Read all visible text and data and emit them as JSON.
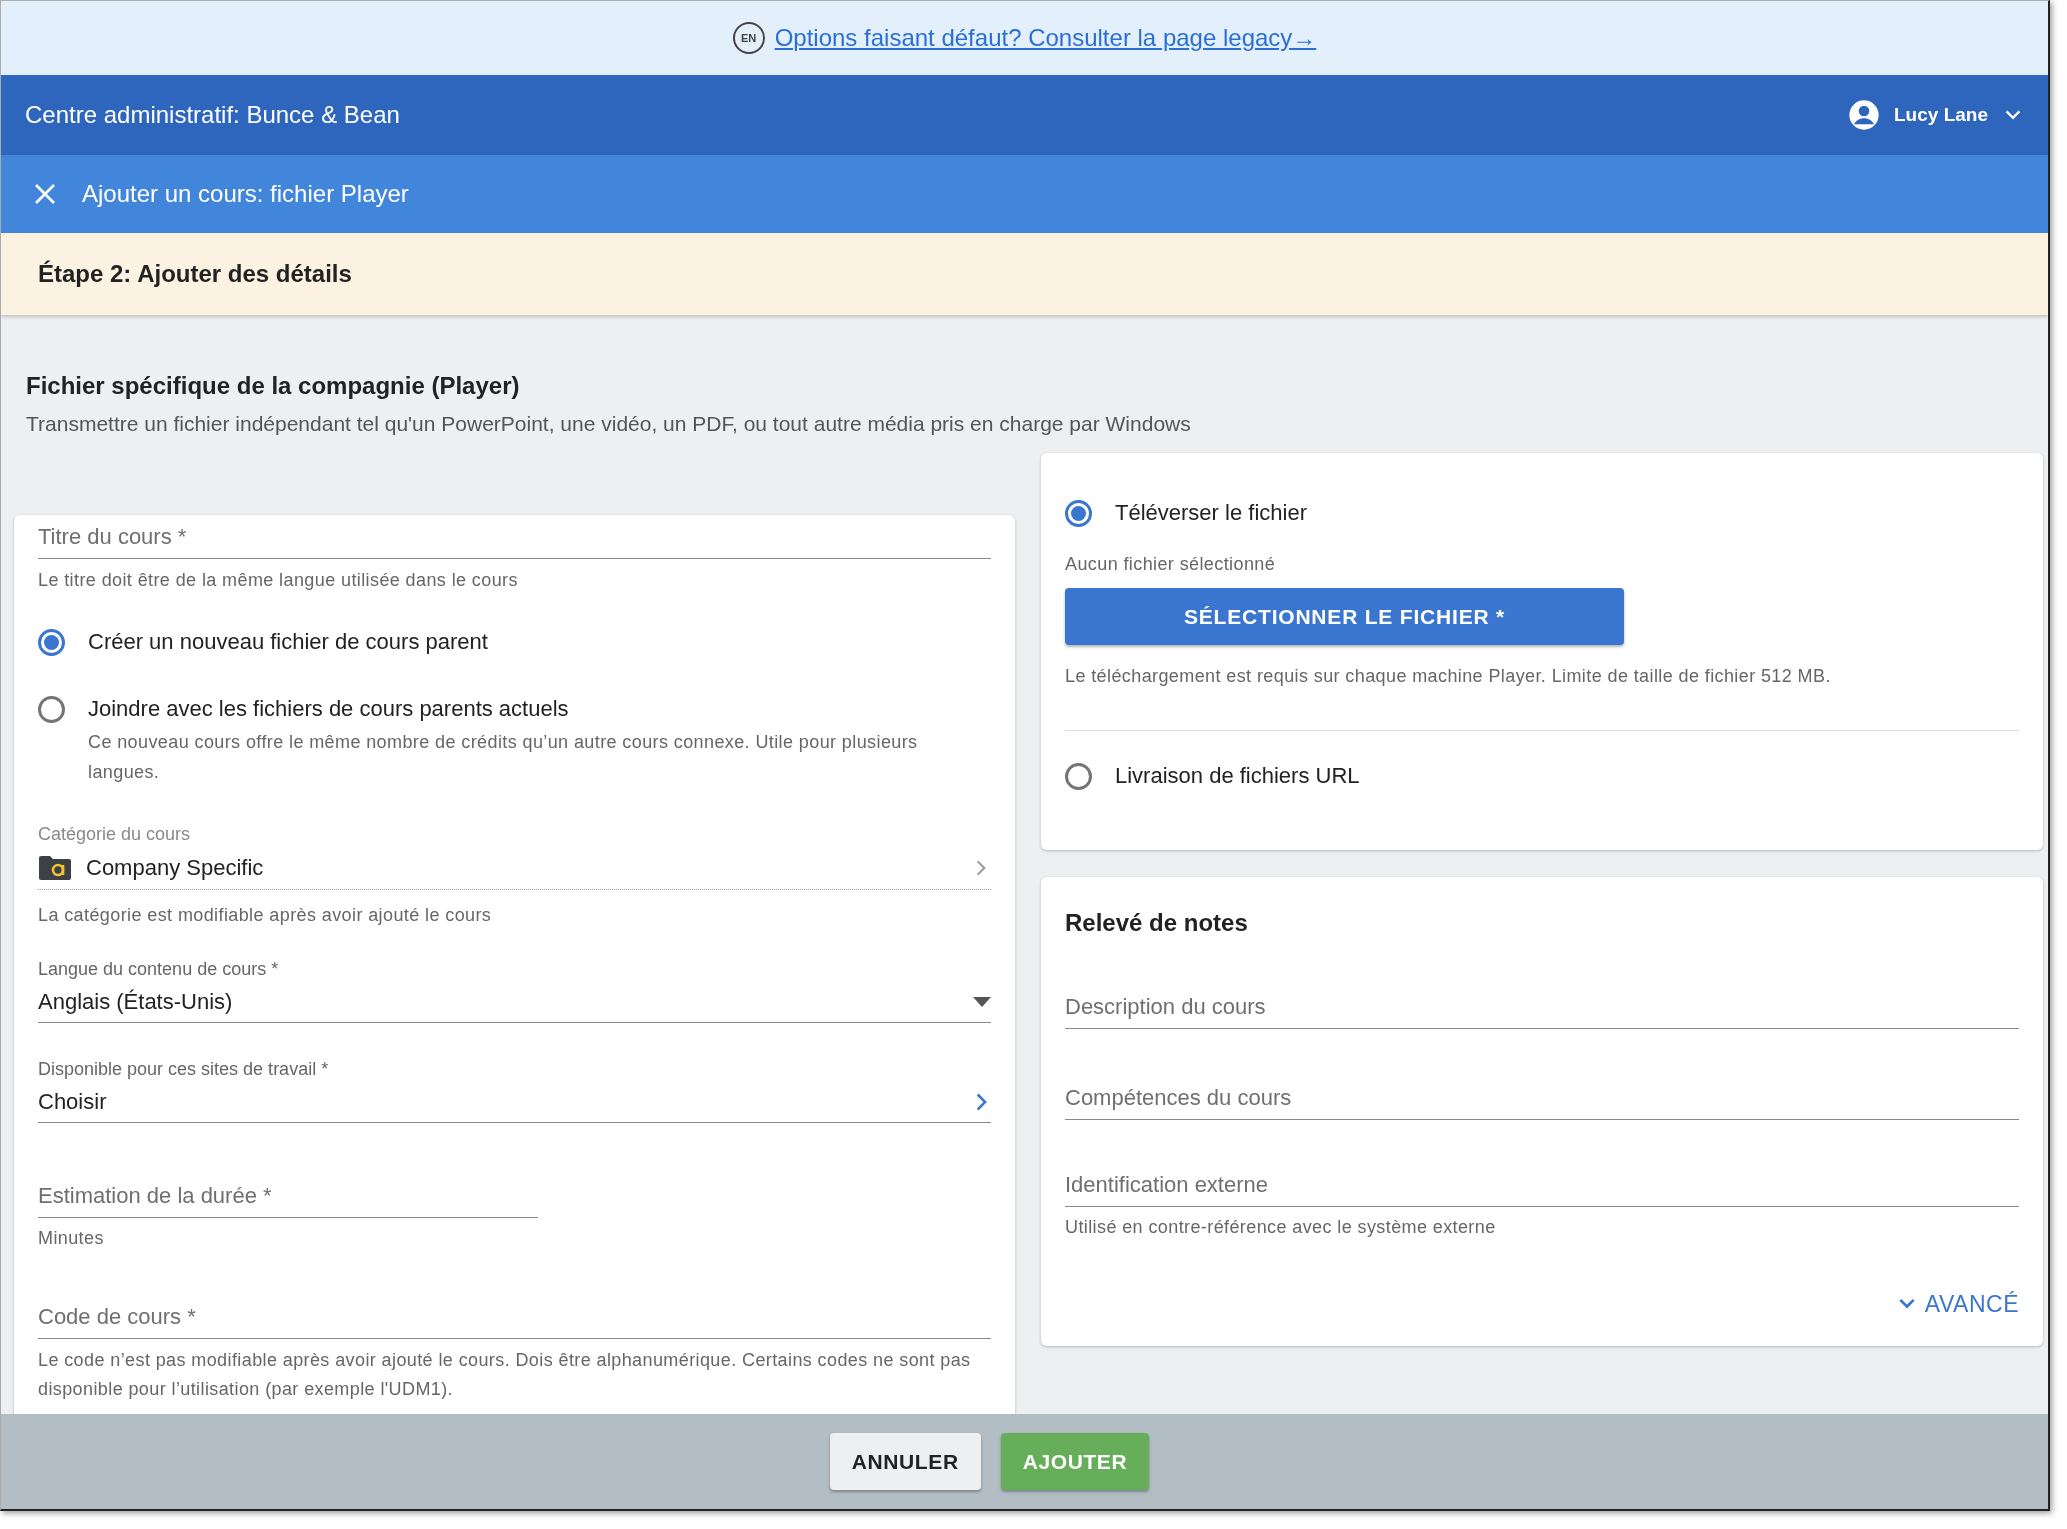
{
  "banner": {
    "language_badge": "EN",
    "link": "Options faisant défaut? Consulter la page legacy→"
  },
  "app_bar": {
    "title": "Centre administratif: Bunce & Bean",
    "user": "Lucy Lane"
  },
  "dialog_bar": {
    "title": "Ajouter un cours: fichier Player"
  },
  "step": {
    "title": "Étape 2: Ajouter des détails"
  },
  "section": {
    "title": "Fichier spécifique de la compagnie (Player)",
    "subtitle": "Transmettre un fichier indépendant tel qu'un PowerPoint, une vidéo, un PDF, ou tout autre média pris en charge par Windows"
  },
  "course_title": {
    "placeholder": "Titre du cours *",
    "helper": "Le titre doit être de la même langue utilisée dans le cours"
  },
  "parent_options": [
    {
      "label": "Créer un nouveau fichier de cours parent",
      "selected": true
    },
    {
      "label": "Joindre avec les fichiers de cours parents actuels",
      "selected": false,
      "helper": "Ce nouveau cours offre le même nombre de crédits qu’un autre cours connexe. Utile pour plusieurs langues."
    }
  ],
  "category": {
    "label": "Catégorie du cours",
    "value": "Company Specific",
    "helper": "La catégorie est modifiable après avoir ajouté le cours"
  },
  "language": {
    "label": "Langue du contenu de cours *",
    "value": "Anglais (États-Unis)"
  },
  "sites": {
    "label": "Disponible pour ces sites de travail *",
    "value": "Choisir"
  },
  "duration": {
    "placeholder": "Estimation de la durée *",
    "helper": "Minutes"
  },
  "code": {
    "placeholder": "Code de cours *",
    "helper": "Le code n’est pas modifiable après avoir ajouté le cours. Dois être alphanumérique. Certains codes ne sont pas disponible pour l’utilisation (par exemple l'UDM1)."
  },
  "delivery": [
    {
      "label": "Téléverser le fichier",
      "selected": true,
      "status": "Aucun fichier sélectionné",
      "button": "SÉLECTIONNER LE FICHIER *",
      "note": "Le téléchargement est requis sur chaque machine Player. Limite de taille de fichier 512 MB."
    },
    {
      "label": "Livraison de fichiers URL",
      "selected": false
    }
  ],
  "transcript": {
    "title": "Relevé de notes",
    "fields": [
      {
        "placeholder": "Description du cours"
      },
      {
        "placeholder": "Compétences du cours"
      },
      {
        "placeholder": "Identification externe",
        "helper": "Utilisé en contre-référence avec le système externe"
      }
    ],
    "advanced": "AVANCÉ"
  },
  "footer": {
    "buttons": [
      {
        "label": "ANNULER",
        "kind": "secondary"
      },
      {
        "label": "AJOUTER",
        "kind": "primary"
      }
    ]
  }
}
